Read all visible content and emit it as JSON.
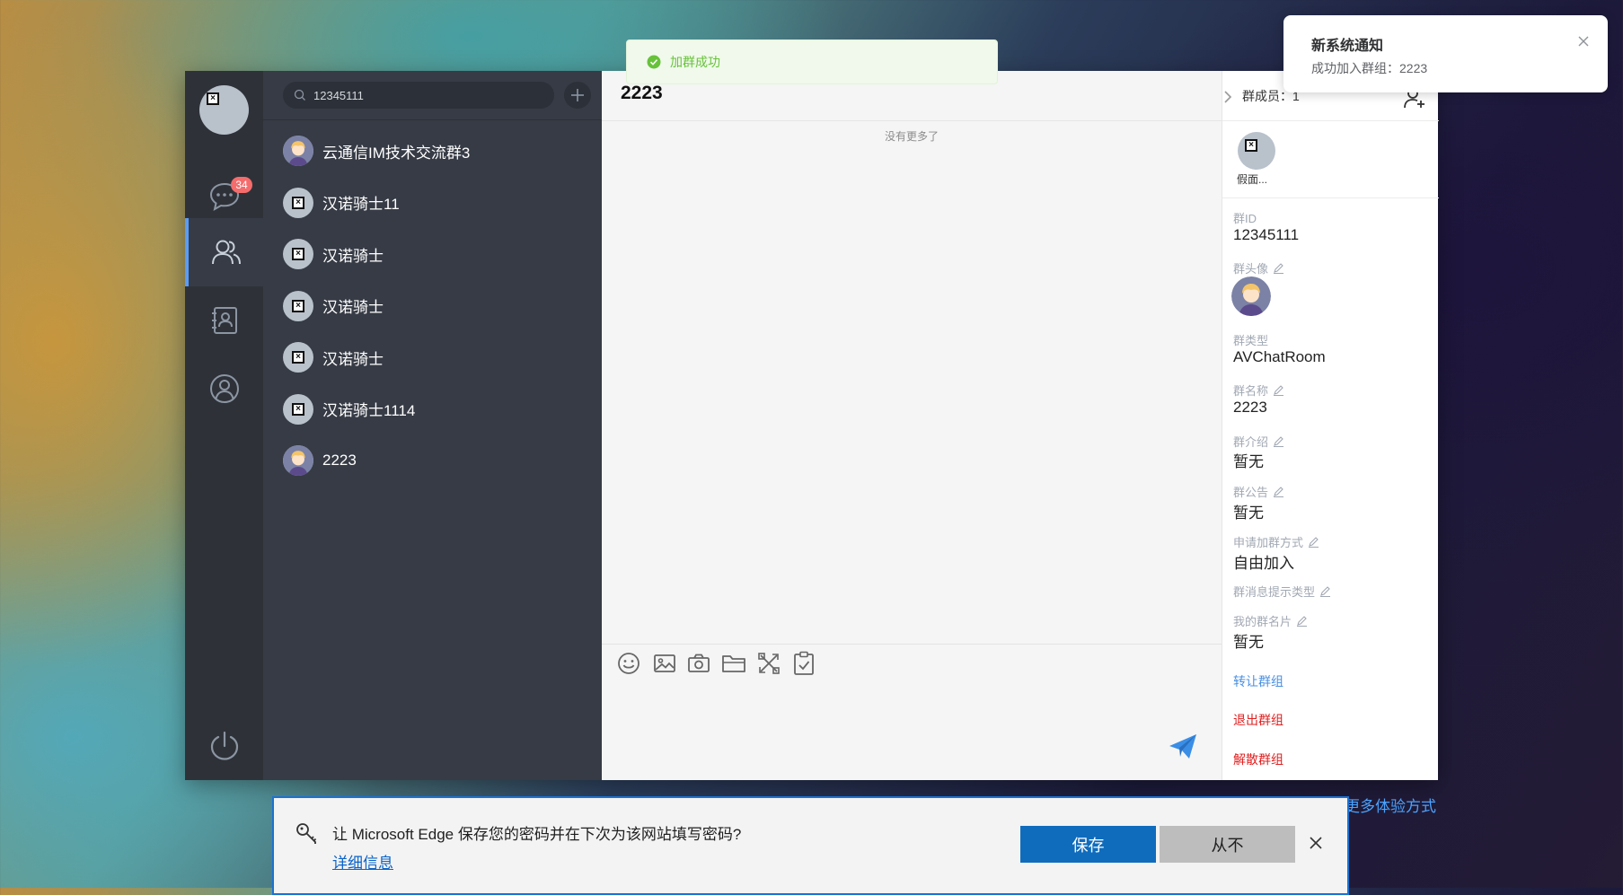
{
  "nav": {
    "unread_badge": "34",
    "items": [
      {
        "icon": "chat-bubble-icon"
      },
      {
        "icon": "group-icon"
      },
      {
        "icon": "contacts-book-icon"
      },
      {
        "icon": "user-circle-icon"
      }
    ],
    "power_icon": "power-icon"
  },
  "search": {
    "value": "12345111"
  },
  "groups": [
    {
      "name": "云通信IM技术交流群3",
      "avatar": "cartoon"
    },
    {
      "name": "汉诺骑士11",
      "avatar": "broken"
    },
    {
      "name": "汉诺骑士",
      "avatar": "broken"
    },
    {
      "name": "汉诺骑士",
      "avatar": "broken"
    },
    {
      "name": "汉诺骑士",
      "avatar": "broken"
    },
    {
      "name": "汉诺骑士1114",
      "avatar": "broken"
    },
    {
      "name": "2223",
      "avatar": "cartoon"
    }
  ],
  "chat": {
    "title": "2223",
    "no_more": "没有更多了"
  },
  "panel": {
    "members_label": "群成员：1",
    "member_name": "假面...",
    "group_id_label": "群ID",
    "group_id_value": "12345111",
    "avatar_label": "群头像",
    "type_label": "群类型",
    "type_value": "AVChatRoom",
    "name_label": "群名称",
    "name_value": "2223",
    "intro_label": "群介绍",
    "intro_value": "暂无",
    "notice_label": "群公告",
    "notice_value": "暂无",
    "join_label": "申请加群方式",
    "join_value": "自由加入",
    "msg_tip_label": "群消息提示类型",
    "card_label": "我的群名片",
    "card_value": "暂无",
    "transfer": "转让群组",
    "quit": "退出群组",
    "dismiss": "解散群组"
  },
  "toast": {
    "text": "加群成功"
  },
  "notification": {
    "title": "新系统通知",
    "body": "成功加入群组：2223"
  },
  "more_link": "更多体验方式",
  "edge": {
    "prompt": "让 Microsoft Edge 保存您的密码并在下次为该网站填写密码?",
    "details": "详细信息",
    "save": "保存",
    "never": "从不"
  },
  "colors": {
    "accent": "#5a9cf8",
    "danger": "#f56c6c",
    "success": "#67c23a",
    "link": "#4a90e2"
  }
}
